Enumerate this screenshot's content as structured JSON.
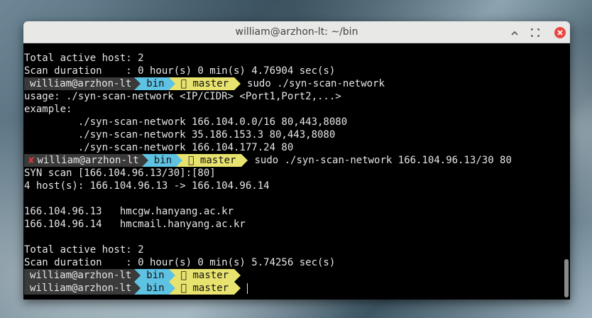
{
  "window": {
    "title": "william@arzhon-lt: ~/bin"
  },
  "colors": {
    "segment_user": "#3a3a3a",
    "segment_dir": "#5ec2e3",
    "segment_git": "#e8e36f",
    "error_mark": "#e0393e",
    "close_button": "#e9473f"
  },
  "prompt": {
    "user": "william@arzhon-lt",
    "dir": "bin",
    "branch_icon": "",
    "branch": "master",
    "error_mark": "✘"
  },
  "output": {
    "l1": "Total active host: 2",
    "l2": "Scan duration    : 0 hour(s) 0 min(s) 4.76904 sec(s)",
    "cmd1": "sudo ./syn-scan-network",
    "l4": "usage: ./syn-scan-network <IP/CIDR> <Port1,Port2,...>",
    "l5": "example:",
    "l6": "         ./syn-scan-network 166.104.0.0/16 80,443,8080",
    "l7": "         ./syn-scan-network 35.186.153.3 80,443,8080",
    "l8": "         ./syn-scan-network 166.104.177.24 80",
    "cmd2": "sudo ./syn-scan-network 166.104.96.13/30 80",
    "l10": "SYN scan [166.104.96.13/30]:[80]",
    "l11": "4 host(s): 166.104.96.13 -> 166.104.96.14",
    "l13": "166.104.96.13   hmcgw.hanyang.ac.kr",
    "l14": "166.104.96.14   hmcmail.hanyang.ac.kr",
    "l16": "Total active host: 2",
    "l17": "Scan duration    : 0 hour(s) 0 min(s) 5.74256 sec(s)"
  }
}
